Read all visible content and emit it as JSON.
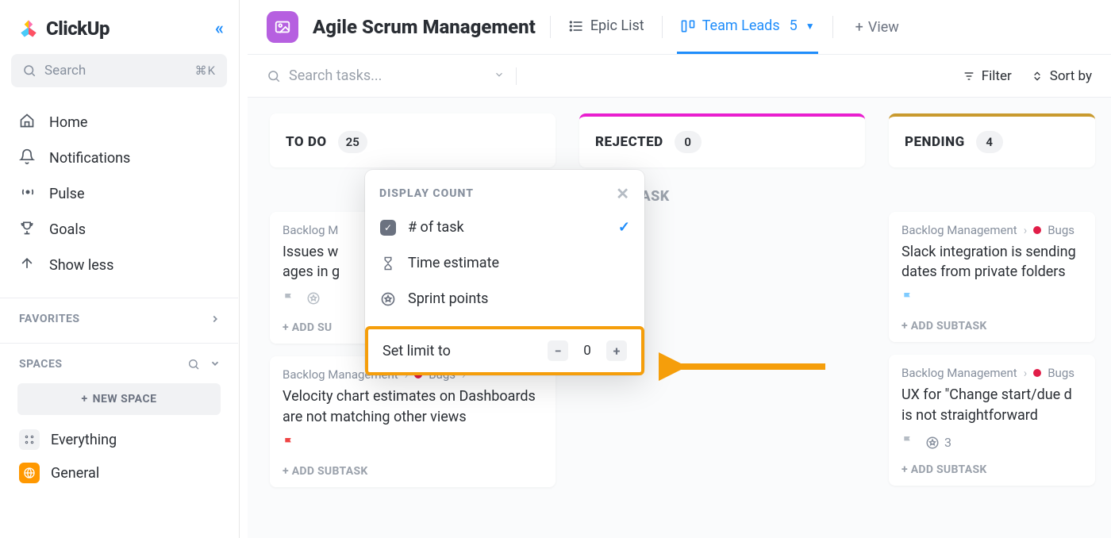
{
  "brand": {
    "name": "ClickUp"
  },
  "sidebar": {
    "search_placeholder": "Search",
    "search_shortcut": "⌘K",
    "nav": [
      {
        "label": "Home"
      },
      {
        "label": "Notifications"
      },
      {
        "label": "Pulse"
      },
      {
        "label": "Goals"
      },
      {
        "label": "Show less"
      }
    ],
    "favorites_label": "FAVORITES",
    "spaces_label": "SPACES",
    "new_space": "NEW SPACE",
    "spaces": [
      {
        "label": "Everything"
      },
      {
        "label": "General"
      }
    ]
  },
  "header": {
    "title": "Agile Scrum Management",
    "tabs": [
      {
        "label": "Epic List"
      },
      {
        "label": "Team Leads",
        "count": "5"
      }
    ],
    "add_view": "View"
  },
  "toolbar": {
    "search_placeholder": "Search tasks...",
    "filter": "Filter",
    "sort_by": "Sort by"
  },
  "board": {
    "columns": [
      {
        "name": "TO DO",
        "count": "25",
        "cards": [
          {
            "crumb1": "Backlog M",
            "title": "Issues w\nages in g",
            "add_subtask": "+ ADD SU"
          },
          {
            "crumb1": "Backlog Management",
            "crumb2": "Bugs",
            "title": "Velocity chart estimates on Dashboards are not matching other views",
            "add_subtask": "+ ADD SUBTASK"
          }
        ]
      },
      {
        "name": "REJECTED",
        "count": "0",
        "new_task": "W TASK"
      },
      {
        "name": "PENDING",
        "count": "4",
        "cards": [
          {
            "crumb1": "Backlog Management",
            "crumb2": "Bugs",
            "title": "Slack integration is sending dates from private folders",
            "add_subtask": "+ ADD SUBTASK"
          },
          {
            "crumb1": "Backlog Management",
            "crumb2": "Bugs",
            "title": "UX for \"Change start/due d is not straightforward",
            "points": "3",
            "add_subtask": "+ ADD SUBTASK"
          }
        ]
      }
    ]
  },
  "popover": {
    "title": "DISPLAY COUNT",
    "options": [
      {
        "label": "# of task",
        "selected": true
      },
      {
        "label": "Time estimate"
      },
      {
        "label": "Sprint points"
      }
    ],
    "limit_label": "Set limit to",
    "limit_value": "0"
  }
}
